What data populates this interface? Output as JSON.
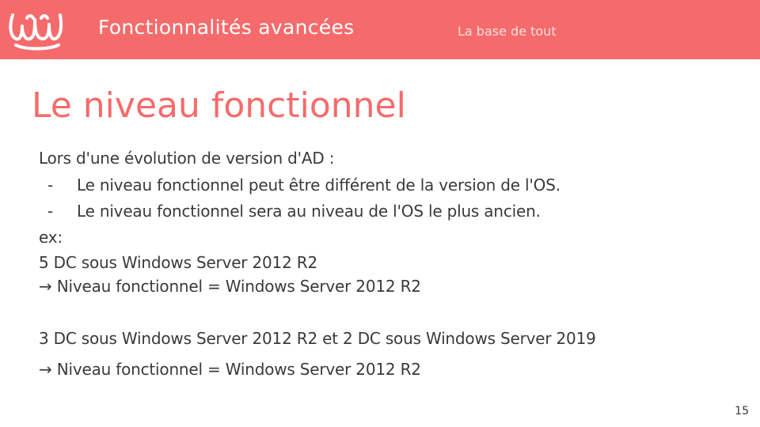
{
  "header": {
    "section_title": "Fonctionnalités avancées",
    "section_subtitle": "La base de tout",
    "logo_icon": "wave-logo-icon",
    "background_color": "#f56b6b"
  },
  "slide": {
    "title": "Le niveau fonctionnel",
    "intro": "Lors d'une évolution de version d'AD :",
    "bullet_marker": "-",
    "bullets": [
      "Le niveau fonctionnel peut être différent de la version de l'OS.",
      "Le niveau fonctionnel sera au niveau de l'OS le plus ancien."
    ],
    "example_label": "ex:",
    "example1_line1": "5 DC sous Windows Server 2012 R2",
    "example1_line2": "→ Niveau fonctionnel = Windows Server 2012 R2",
    "example2_line1": "3 DC sous Windows Server 2012 R2 et 2 DC sous Windows Server 2019",
    "example2_line2": "→ Niveau fonctionnel = Windows Server 2012 R2",
    "title_color": "#f56b6b"
  },
  "footer": {
    "page_number": "15"
  }
}
